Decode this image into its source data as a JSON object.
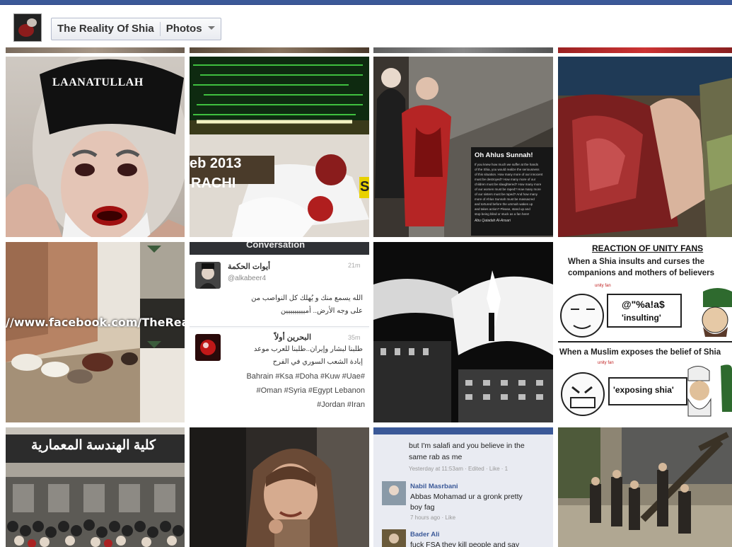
{
  "header": {
    "page_name": "The Reality Of Shia",
    "section_label": "Photos"
  },
  "photos": {
    "p1": {
      "caption": "LAANATULLAH"
    },
    "p2": {
      "date_text": "eb 2013",
      "city_text": "RACHI",
      "letter": "S"
    },
    "p3": {
      "title": "Oh Ahlus Sunnah!",
      "body_lines": [
        "If you knew how much we suffer at the hands",
        "of the Shia, you would realize the seriousness",
        "of this situation. How many more of our innocent",
        "must be destroyed? How many more of our",
        "children must be slaughtered? How many more",
        "of our women must be raped? How many more",
        "of our sisters must be raped? And how many",
        "more of Ahlus Sunnah must be massacred",
        "and tortured before the ummah wakes up",
        "and takes action? Please, stand up and",
        "stop being blind or stuck as a fan here!"
      ],
      "signature": "Abu Qatadah Al-Ansari"
    },
    "p5": {
      "url_text": "//www.facebook.com/TheRea"
    },
    "p6": {
      "header": "Conversation",
      "tweet1_name": "أيوات الحكمة",
      "tweet1_handle": "@alkabeer4",
      "tweet1_time": "21m",
      "tweet1_lines": [
        "الله يسمع منك و يُهلك كل النواصب من",
        "على وجه الأرض.. أمييييييييين"
      ],
      "tweet2_name": "البحرين أولاً",
      "tweet2_time": "35m",
      "tweet2_lines": [
        "طلبنا لبشار وإيران..طلبنا للعرب موعد",
        "إبادة الشعب السوري في الفرح"
      ],
      "tweet2_tags": [
        "Bahrain #Ksa #Doha #Kuw #Uae#",
        "#Oman #Syria #Egypt Lebanon",
        "#Jordan #Iran"
      ]
    },
    "p8": {
      "title": "REACTION OF UNITY FANS",
      "line1": "When a Shia insults and curses the",
      "line2": "companions and mothers of believers",
      "small1": "unity fan",
      "bubble1": "@\"%a!a$",
      "bubble1b": "'insulting'",
      "line3": "When a Muslim exposes the belief of Shia",
      "small2": "unity fan",
      "bubble2": "'exposing shia'"
    },
    "p9": {
      "sign": "كلية الهندسة المعمارية"
    },
    "p11": {
      "line1": "but I'm salafi and you believe in the",
      "line2": "same rab as me",
      "meta1": "Yesterday at 11:53am · Edited · Like · 1",
      "name2": "Nabil Masrbani",
      "line3": "Abbas Mohamad ur a gronk pretty",
      "line4": "boy fag",
      "meta2": "7 hours ago · Like",
      "name3": "Bader Ali",
      "line5": "fuck FSA they kill people and say"
    }
  },
  "colors": {
    "facebook_blue": "#3b5998",
    "link_blue": "#3b5998"
  }
}
